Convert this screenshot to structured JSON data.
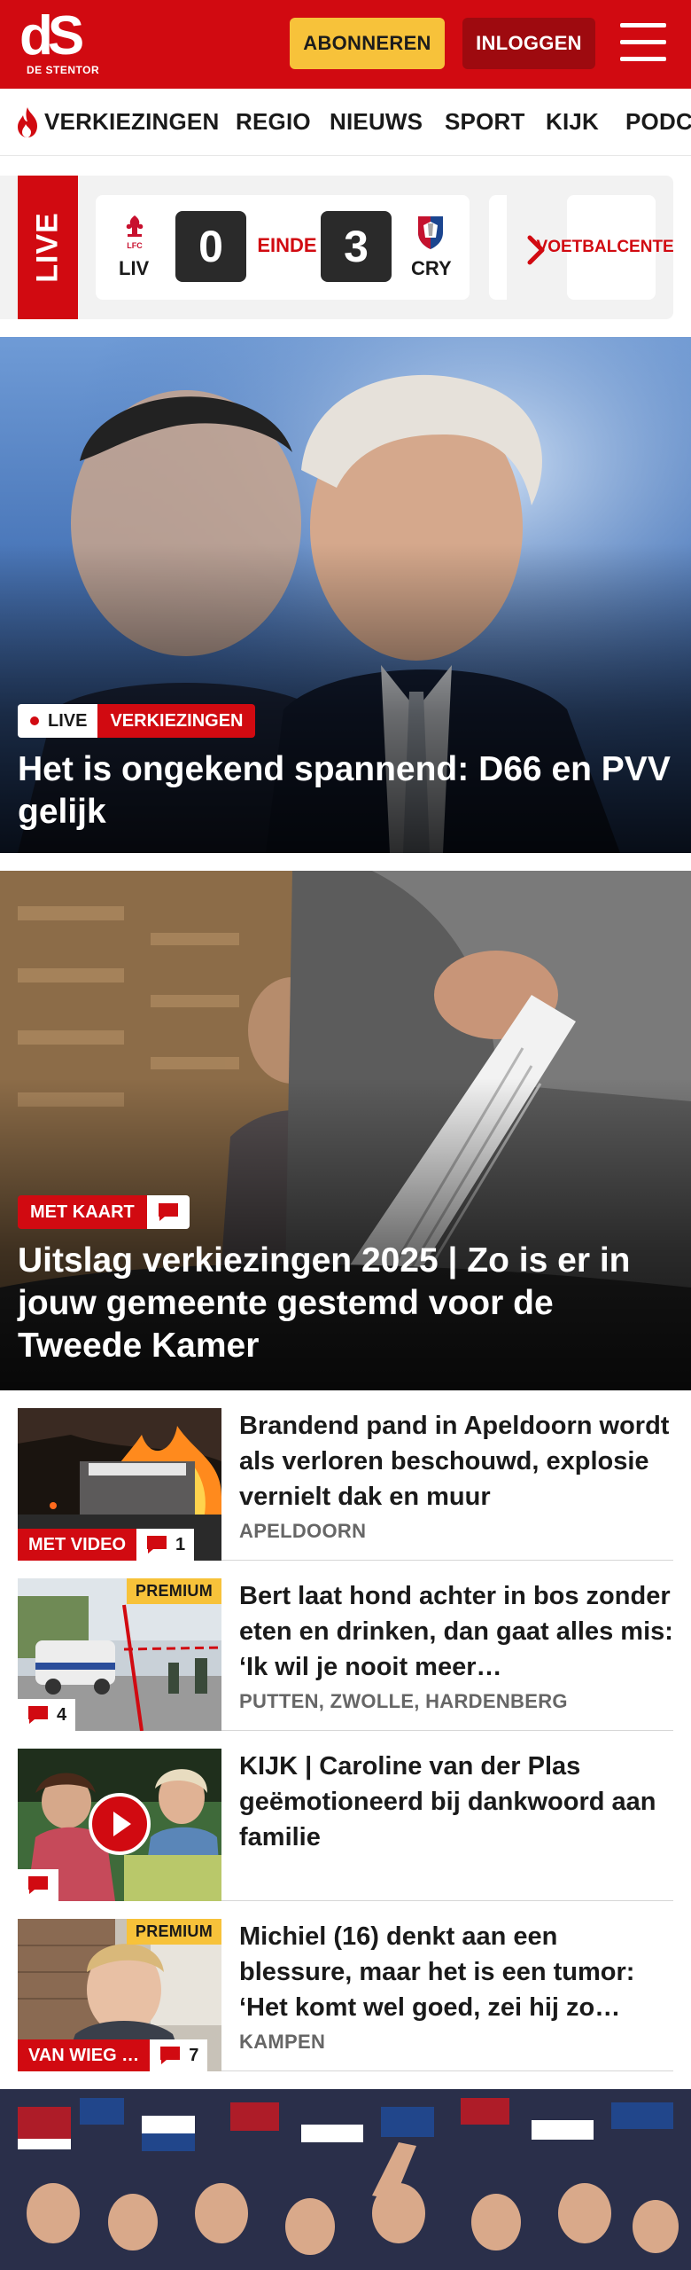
{
  "header": {
    "logo_mark": "dS",
    "logo_sub": "DE STENTOR",
    "subscribe_label": "ABONNEREN",
    "login_label": "INLOGGEN",
    "menu_icon": "hamburger-menu-icon",
    "brand_color": "#d10a11",
    "accent_color": "#f7c23a"
  },
  "nav": {
    "items": [
      "VERKIEZINGEN",
      "REGIO",
      "NIEUWS",
      "SPORT",
      "KIJK",
      "PODCAST"
    ],
    "first_item_icon": "flame-icon"
  },
  "live": {
    "label": "LIVE",
    "match": {
      "home_abbr": "LIV",
      "home_score": "0",
      "status": "EINDE",
      "away_score": "3",
      "away_abbr": "CRY"
    },
    "voetbal_center_label": "VOETBAL CENTER"
  },
  "hero1": {
    "live_tag": "LIVE",
    "category_tag": "VERKIEZINGEN",
    "title": "Het is ongekend spannend: D66 en PVV gelijk"
  },
  "hero2": {
    "tag": "MET KAART",
    "title": "Uitslag verkiezingen 2025 | Zo is er in jouw gemeente gestemd voor de Tweede Kamer"
  },
  "articles": [
    {
      "title": "Brandend pand in Apeldoorn wordt als verloren beschouwd, explosie vernielt dak en muur",
      "location": "APELDOORN",
      "tag": "MET VIDEO",
      "comments": "1",
      "premium": ""
    },
    {
      "title": "Bert laat hond achter in bos zonder eten en drinken, dan gaat alles mis: ‘Ik wil je nooit meer…",
      "location": "PUTTEN, ZWOLLE, HARDENBERG",
      "tag": "",
      "comments": "4",
      "premium": "PREMIUM"
    },
    {
      "title": "KIJK | Caroline van der Plas geëmotioneerd bij dankwoord aan familie",
      "location": "",
      "tag": "",
      "comments": "",
      "premium": ""
    },
    {
      "title": "Michiel (16) denkt aan een blessure, maar het is een tumor: ‘Het komt wel goed, zei hij zo…",
      "location": "KAMPEN",
      "tag": "VAN WIEG …",
      "comments": "7",
      "premium": "PREMIUM"
    }
  ]
}
